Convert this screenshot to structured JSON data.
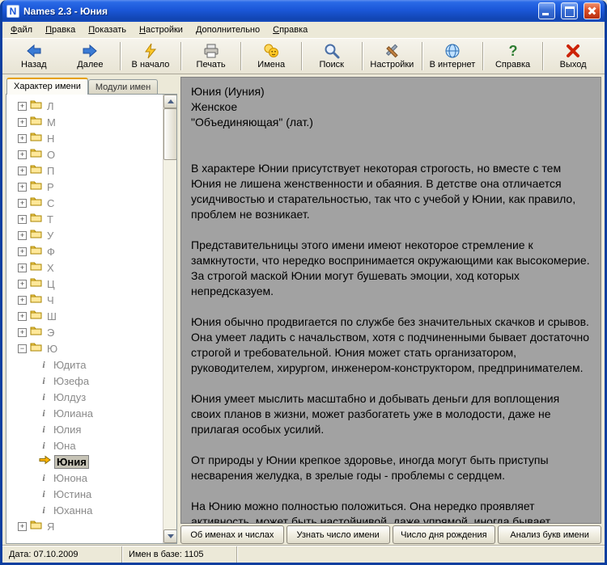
{
  "window": {
    "title": "Names 2.3 - Юния",
    "icon_letter": "N"
  },
  "colors": {
    "titlebar_blue": "#1B57D8",
    "window_face": "#ECE9D8",
    "content_background": "#A2A2A2",
    "selection_arrow_orange": "#FFB300",
    "close_button_red": "#DA4E26"
  },
  "menu": {
    "items": [
      {
        "id": "file",
        "label": "Файл"
      },
      {
        "id": "edit",
        "label": "Правка"
      },
      {
        "id": "view",
        "label": "Показать"
      },
      {
        "id": "settings",
        "label": "Настройки"
      },
      {
        "id": "extra",
        "label": "Дополнительно"
      },
      {
        "id": "help",
        "label": "Справка"
      }
    ]
  },
  "toolbar": {
    "buttons": [
      {
        "icon": "back",
        "label": "Назад",
        "separator_after": false
      },
      {
        "icon": "forward",
        "label": "Далее",
        "separator_after": true
      },
      {
        "icon": "home",
        "label": "В начало",
        "separator_after": true
      },
      {
        "icon": "print",
        "label": "Печать",
        "separator_after": true
      },
      {
        "icon": "names",
        "label": "Имена",
        "separator_after": true
      },
      {
        "icon": "search",
        "label": "Поиск",
        "separator_after": true
      },
      {
        "icon": "settings",
        "label": "Настройки",
        "separator_after": true
      },
      {
        "icon": "internet",
        "label": "В интернет",
        "separator_after": true
      },
      {
        "icon": "help",
        "label": "Справка",
        "separator_after": true
      },
      {
        "icon": "exit",
        "label": "Выход",
        "separator_after": false
      }
    ]
  },
  "tabs": [
    {
      "id": "character",
      "label": "Характер имени",
      "active": true
    },
    {
      "id": "modules",
      "label": "Модули имен",
      "active": false
    }
  ],
  "tree": {
    "collapsed_letters_before": [
      "Л",
      "М",
      "Н",
      "О",
      "П",
      "Р",
      "С",
      "Т",
      "У",
      "Ф",
      "Х",
      "Ц",
      "Ч",
      "Ш",
      "Э"
    ],
    "expanded_letter": "Ю",
    "names": [
      "Юдита",
      "Юзефа",
      "Юлдуз",
      "Юлиана",
      "Юлия",
      "Юна",
      "Юния",
      "Юнона",
      "Юстина",
      "Юханна"
    ],
    "selected_name": "Юния",
    "collapsed_letters_after": [
      "Я"
    ]
  },
  "content": {
    "header_lines": [
      "Юния (Иуния)",
      "Женское",
      "\"Объединяющая\" (лат.)"
    ],
    "paragraphs": [
      "В характере Юнии присутствует некоторая строгость, но вместе с тем Юния не лишена женственности и обаяния. В детстве она отличается усидчивостью и старательностью, так что с учебой у Юнии, как правило, проблем не возникает.",
      "Представительницы этого имени имеют некоторое стремление к замкнутости, что нередко воспринимается окружающими как высокомерие. За строгой маской Юнии могут бушевать эмоции, ход которых непредсказуем.",
      "Юния обычно продвигается по службе без значительных скачков и срывов. Она умеет ладить с начальством, хотя с подчиненными бывает достаточно строгой и требовательной. Юния может стать организатором, руководителем, хирургом, инженером-конструктором, предпринимателем.",
      "Юния умеет мыслить масштабно и добывать деньги для воплощения своих планов в жизни, может разбогатеть уже в молодости, даже не прилагая особых усилий.",
      "От природы у Юнии крепкое здоровье, иногда могут быть приступы несварения желудка, в зрелые годы - проблемы с сердцем.",
      "На Юнию можно полностью положиться. Она нередко проявляет активность, может быть настойчивой, даже упрямой, иногда бывает заводной, но чаще всего она все же знает ту черту, дальше которой нельзя заходить в конфликтных"
    ]
  },
  "bottom_buttons": [
    "Об именах и числах",
    "Узнать число имени",
    "Число дня рождения",
    "Анализ букв имени"
  ],
  "status": {
    "date": "Дата: 07.10.2009",
    "count": "Имен в базе: 1105"
  }
}
